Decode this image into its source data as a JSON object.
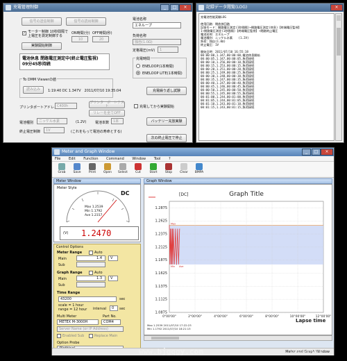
{
  "win1": {
    "title": "充電管理制御",
    "btn_write_device": "信号の送信制御",
    "btn_read_device": "信号の読出制御",
    "chk_motor": "モーター制御 10秒間隔で\n上電圧を測定制御する",
    "btn_start_measure": "実験開始制御",
    "lbl_on_time": "ON時間(分)",
    "lbl_off_time": "OFF時間(秒)",
    "on_time_value": "10",
    "off_time_value": "20",
    "status_text": "電池休息 閉路電圧測定中(終止電圧監視)\n09分45秒持続",
    "dmm_group_label": "To DMM Viewerの値",
    "btn_dmm": "読み込み",
    "dmm_reading": "1:19:40 DC 1.347V　2011/07/10 19:35:04",
    "lbl_printer_port": "プリンタポートアドレス",
    "printer_port_value": "C400h",
    "btn_printer_test": "プリンターポートテスト",
    "btn_relay_off": "リレーを全てOFF",
    "lbl_battery_type": "電池種別",
    "battery_type_value": "ニッケル水素",
    "lbl_voltage": "(1.2V)",
    "lbl_battery_count": "電池本数",
    "battery_count_value": "1本",
    "lbl_end_voltage": "終止電圧制御",
    "end_voltage_value": "1V",
    "lbl_end_voltage_note": "(これをもって電池の寿命とする)",
    "lbl_battery_name": "電池名称",
    "battery_name_value": "エネループ",
    "lbl_model": "負荷名称",
    "model_value": "独自(1.0Ω)",
    "lbl_rated": "定格電圧(mV)",
    "rated_value": "1",
    "charge_group_label": "充電時間",
    "radio_eneloop": "ENELOOP(1本時間)",
    "radio_eneloop_lite": "ENELOOP LITE(1本時間)",
    "btn_charge_repeat": "充電繰り返し試験",
    "chk_after_charge": "充電してから実験開始",
    "btn_battery": "バッテリー充放実験",
    "btn_stop": "次の終止電圧で停止"
  },
  "win2": {
    "title": "記録データ閲覧(LOG)",
    "log_lines": [
      "充電池性能実験LOG",
      "",
      "使用回路：閉放放回路",
      "記録モード：開路電圧測定(1秒間隔)→閉路電圧測定(休息)【終端電圧監視】",
      "1→閉路電圧測定(1秒間隔)【終端電圧監視】→閉路終止電圧",
      "電池名称：エネループ",
      "電池種別：ニッケル水素　　(1.2V)",
      "負荷：独自(1.0Ω)",
      "終止電圧：1V",
      "",
      "開始日時：2011/07/10 16:55:18",
      "00:00:00,1.347,00:00:00,電池休息開始",
      "00:00:05,1.347,00:00:05,負荷接続",
      "00:00:10,1.256,00:00:10,負荷接続",
      "00:00:15,1.253,00:00:15,負荷接続",
      "00:00:20,1.251,00:00:20,負荷接続",
      "00:00:25,1.249,00:00:25,負荷接続",
      "00:00:30,1.248,00:00:30,負荷接続",
      "00:00:35,1.247,00:00:35,負荷接続",
      "00:00:40,1.247,00:00:40,負荷接続",
      "00:00:45,1.246,00:00:45,負荷接続",
      "00:00:50,1.245,00:00:50,負荷接続",
      "00:00:55,1.245,00:00:55,負荷接続",
      "00:01:00,1.244,00:01:00,負荷接続",
      "00:01:05,1.244,00:01:05,負荷接続",
      "00:01:10,1.243,00:01:10,負荷接続",
      "00:01:15,1.243,00:01:15,負荷接続"
    ]
  },
  "win3": {
    "title": "Meter and Graph Window",
    "menu": [
      "File",
      "Edit",
      "Function",
      "Command",
      "Window",
      "Tool",
      "?"
    ],
    "tools": [
      {
        "label": "Grab",
        "color": "#7aa"
      },
      {
        "label": "Save",
        "color": "#58c"
      },
      {
        "label": "Print",
        "color": "#666"
      },
      {
        "label": "Open",
        "color": "#c93"
      },
      {
        "label": "Select",
        "color": "#aaa"
      },
      {
        "label": "Cut",
        "color": "#c33"
      },
      {
        "label": "Start",
        "color": "#3a3"
      },
      {
        "label": "Stop",
        "color": "#a33"
      },
      {
        "label": "Clear",
        "color": "#ccc"
      },
      {
        "label": "BMPA",
        "color": "#48c"
      }
    ],
    "meter_panel": "Meter Window",
    "meter_title": "Meter Style",
    "meter_unit": "DC",
    "meter_max": "Max  1.2539",
    "meter_min": "Min  1.1792",
    "meter_ave": "Ave  1.2317",
    "meter_value": "1.2470",
    "meter_units_mark": "(V)",
    "control_label": "Control Options",
    "meter_range_label": "Meter Range",
    "main_label": "Main",
    "sub_label": "Sub",
    "auto_label": "Auto",
    "meter_main_val": "1.4",
    "graph_range_label": "Graph Range",
    "graph_main_val": "1.3",
    "time_range_label": "Time Range",
    "time_range_value": "43200",
    "sec_label": "sec",
    "scale_note": "scale = 1 hour\nrange = 12 hour",
    "interval_label": "interval",
    "interval_value": "0",
    "multi_meter_label": "Multi Meter",
    "part_no_label": "Part No.",
    "multi_meter_value": "METEX M-3000H",
    "port_value": "COM4",
    "server_label": "Server Name (or IP Address)",
    "enabled_sub": "Enabled Sub",
    "replace_main": "Replace Main",
    "option_probe_label": "Option Probe",
    "option_probe_value": "(Nothing)",
    "graph_panel": "Graph Window",
    "graph_info_line1": "Max  1.2539   2011/07/10 17:22:23",
    "graph_info_line2": "Min  1.1792   2011/07/10 18:21:13",
    "status_text": "Meter and Graph Window"
  },
  "chart_data": {
    "type": "line",
    "title": "Graph Title",
    "ylabel": "[DC]",
    "xlabel": "Lapse time",
    "y_ticks": [
      "1.2875",
      "1.2625",
      "1.2375",
      "1.2125",
      "1.1875",
      "1.1625",
      "1.1375",
      "1.1125",
      "1.0875"
    ],
    "x_ticks": [
      "0°00'00\"",
      "2°00'00\"",
      "4°00'00\"",
      "6°00'00\"",
      "8°00'00\"",
      "10°00'00\"",
      "12°00'00\""
    ],
    "ylim": [
      1.0875,
      1.3
    ],
    "series": [
      {
        "color": "#e04040",
        "x": [
          0,
          0.02,
          0.04,
          0.06,
          0.08,
          0.1,
          0.12,
          0.14,
          0.16,
          0.2,
          0.24,
          0.28,
          0.32,
          0.36,
          0.4
        ],
        "y": [
          1.2539,
          1.18,
          1.247,
          1.18,
          1.247,
          1.18,
          1.247,
          1.18,
          1.247,
          1.18,
          1.247,
          1.1792,
          1.247,
          1.18,
          1.247
        ]
      }
    ],
    "band_lower": 1.1792,
    "band_upper": 1.2539,
    "max_line": 1.2539,
    "min_label": "Min",
    "max_label": "Max",
    "avg_label": "Ave"
  },
  "watermark": {
    "url": "www.bjgqgy.com",
    "site": "www.evolife.cn"
  }
}
